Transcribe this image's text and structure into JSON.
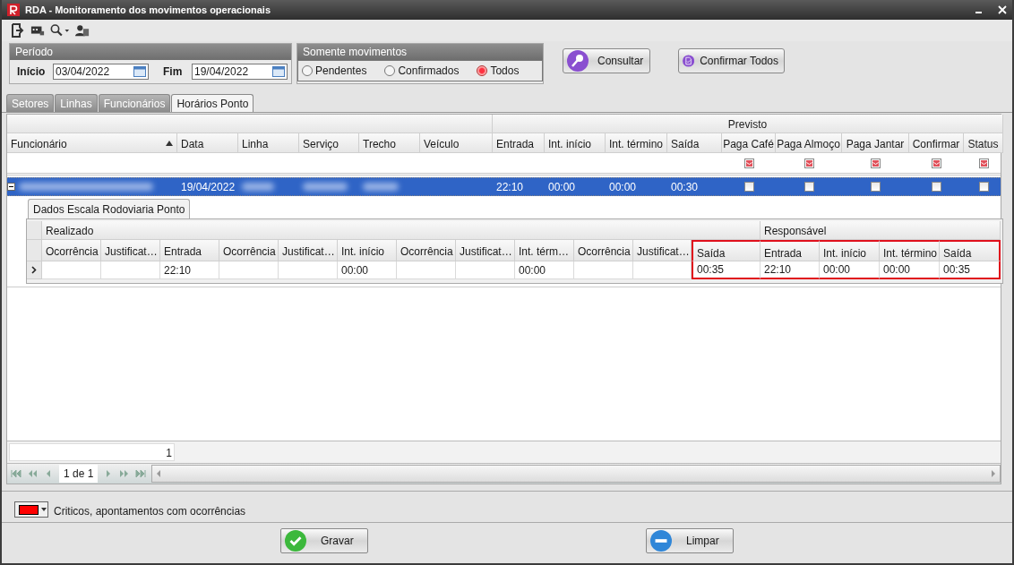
{
  "window": {
    "title": "RDA - Monitoramento dos movimentos operacionais"
  },
  "periodo": {
    "title": "Período",
    "start_label": "Início",
    "start_value": "03/04/2022",
    "end_label": "Fim",
    "end_value": "19/04/2022"
  },
  "filter": {
    "title": "Somente movimentos",
    "options": [
      {
        "label": "Pendentes",
        "selected": false
      },
      {
        "label": "Confirmados",
        "selected": false
      },
      {
        "label": "Todos",
        "selected": true
      }
    ]
  },
  "actions": [
    {
      "label": "Consultar",
      "kind": "search"
    },
    {
      "label": "Confirmar Todos",
      "kind": "confirm"
    }
  ],
  "tabs": [
    {
      "label": "Setores",
      "selected": false
    },
    {
      "label": "Linhas",
      "selected": false
    },
    {
      "label": "Funcionários",
      "selected": false
    },
    {
      "label": "Horários Ponto",
      "selected": true
    }
  ],
  "grid": {
    "band": "Previsto",
    "columns": [
      {
        "label": "Funcionário",
        "kind": "text",
        "sorted": true
      },
      {
        "label": "Data",
        "kind": "text",
        "sorted": false
      },
      {
        "label": "Linha",
        "kind": "text",
        "sorted": false
      },
      {
        "label": "Serviço",
        "kind": "text",
        "sorted": false
      },
      {
        "label": "Trecho",
        "kind": "text",
        "sorted": false
      },
      {
        "label": "Veículo",
        "kind": "text",
        "sorted": false
      },
      {
        "label": "Entrada",
        "kind": "text",
        "sorted": false
      },
      {
        "label": "Int. início",
        "kind": "text",
        "sorted": false
      },
      {
        "label": "Int. término",
        "kind": "text",
        "sorted": false
      },
      {
        "label": "Saída",
        "kind": "text",
        "sorted": false
      },
      {
        "label": "Paga Café",
        "kind": "check",
        "sorted": false
      },
      {
        "label": "Paga Almoço",
        "kind": "check",
        "sorted": false
      },
      {
        "label": "Paga Jantar",
        "kind": "check",
        "sorted": false
      },
      {
        "label": "Confirmar",
        "kind": "check",
        "sorted": false
      },
      {
        "label": "Status",
        "kind": "check",
        "sorted": false
      }
    ],
    "rows": [
      {
        "selected": true,
        "expanded": true,
        "cells": [
          {
            "kind": "blurred"
          },
          {
            "kind": "text",
            "text": "19/04/2022"
          },
          {
            "kind": "blurred"
          },
          {
            "kind": "blurred"
          },
          {
            "kind": "blurred"
          },
          {
            "kind": "text"
          },
          {
            "kind": "text",
            "text": "22:10"
          },
          {
            "kind": "text",
            "text": "00:00"
          },
          {
            "kind": "text",
            "text": "00:00"
          },
          {
            "kind": "text",
            "text": "00:30"
          },
          {
            "kind": "check",
            "checked": false
          },
          {
            "kind": "check",
            "checked": false
          },
          {
            "kind": "check",
            "checked": false
          },
          {
            "kind": "check",
            "checked": false
          },
          {
            "kind": "check",
            "checked": false
          }
        ]
      }
    ],
    "count": "1",
    "pager": "1 de 1"
  },
  "detail": {
    "tab": "Dados Escala Rodoviaria Ponto",
    "bands": [
      {
        "label": "Realizado",
        "columns": [
          {
            "label": "Ocorrência",
            "highlighted": false
          },
          {
            "label": "Justificat…",
            "highlighted": false
          },
          {
            "label": "Entrada",
            "highlighted": false
          },
          {
            "label": "Ocorrência",
            "highlighted": false
          },
          {
            "label": "Justificat…",
            "highlighted": false
          },
          {
            "label": "Int. início",
            "highlighted": false
          },
          {
            "label": "Ocorrência",
            "highlighted": false
          },
          {
            "label": "Justificat…",
            "highlighted": false
          },
          {
            "label": "Int. térm…",
            "highlighted": false
          },
          {
            "label": "Ocorrência",
            "highlighted": false
          },
          {
            "label": "Justificat…",
            "highlighted": false
          },
          {
            "label": "Saída",
            "highlighted": true
          }
        ]
      },
      {
        "label": "Responsável",
        "columns": [
          {
            "label": "Entrada",
            "highlighted": true
          },
          {
            "label": "Int. início",
            "highlighted": true
          },
          {
            "label": "Int. término",
            "highlighted": true
          },
          {
            "label": "Saída",
            "highlighted": true
          }
        ]
      }
    ],
    "rows": [
      {
        "current": true,
        "cells": [
          null,
          null,
          "22:10",
          null,
          null,
          "00:00",
          null,
          null,
          "00:00",
          null,
          null,
          "00:35",
          "22:10",
          "00:00",
          "00:00",
          "00:35"
        ]
      }
    ]
  },
  "legend": {
    "color": "#ff0000",
    "label": "Criticos, apontamentos com ocorrências"
  },
  "buttons": [
    {
      "label": "Gravar",
      "kind": "save"
    },
    {
      "label": "Limpar",
      "kind": "clear"
    }
  ]
}
